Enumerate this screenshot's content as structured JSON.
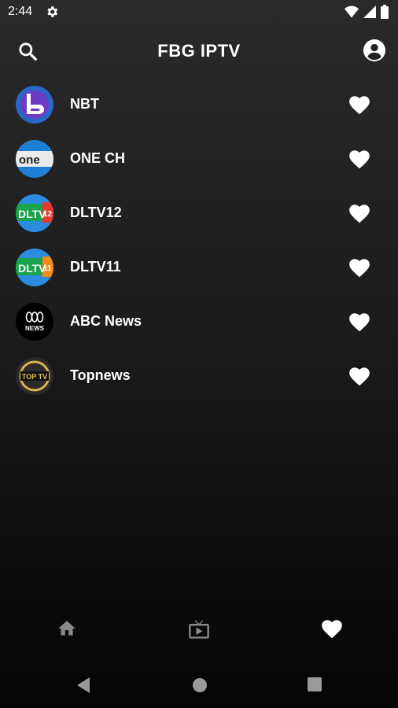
{
  "status": {
    "time": "2:44"
  },
  "appbar": {
    "title": "FBG IPTV"
  },
  "channels": [
    {
      "name": "NBT",
      "logo_icon": "nbt-logo-icon",
      "logo_colors": [
        "#2f6fd0",
        "#7b3bc8"
      ]
    },
    {
      "name": "ONE CH",
      "logo_icon": "one-ch-logo-icon",
      "logo_colors": [
        "#1f7fd6",
        "#ffffff"
      ]
    },
    {
      "name": "DLTV12",
      "logo_icon": "dltv12-logo-icon",
      "logo_colors": [
        "#1aa84a",
        "#e23a2f"
      ],
      "logo_text": "DLTV",
      "logo_num": "12"
    },
    {
      "name": "DLTV11",
      "logo_icon": "dltv11-logo-icon",
      "logo_colors": [
        "#1aa84a",
        "#f28c1b"
      ],
      "logo_text": "DLTV",
      "logo_num": "11"
    },
    {
      "name": "ABC News",
      "logo_icon": "abc-news-logo-icon",
      "logo_colors": [
        "#000000",
        "#ffffff"
      ],
      "logo_text": "ABC NEWS"
    },
    {
      "name": "Topnews",
      "logo_icon": "topnews-logo-icon",
      "logo_colors": [
        "#111111",
        "#d9b24a"
      ],
      "logo_text": "TOP TV"
    }
  ],
  "bottom_nav": [
    {
      "icon": "home-icon",
      "active": false
    },
    {
      "icon": "tv-icon",
      "active": false
    },
    {
      "icon": "favorites-icon",
      "active": true
    }
  ],
  "system_nav": [
    "back-icon",
    "home-circle-icon",
    "recents-icon"
  ]
}
